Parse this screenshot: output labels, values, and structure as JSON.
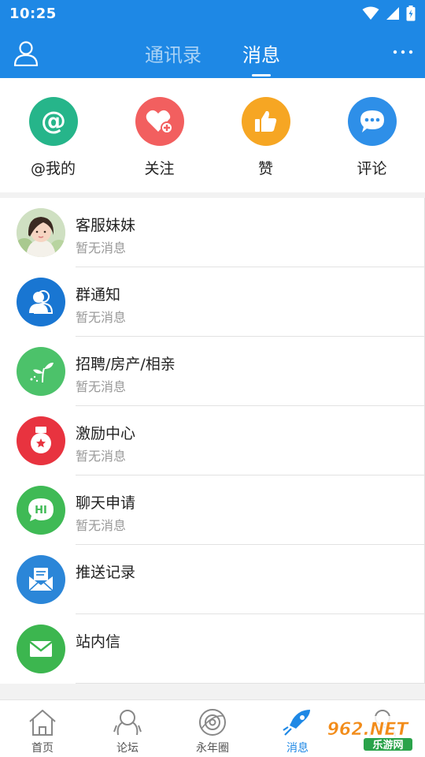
{
  "status": {
    "time": "10:25"
  },
  "nav": {
    "tabs": [
      {
        "label": "通讯录",
        "active": false
      },
      {
        "label": "消息",
        "active": true
      }
    ]
  },
  "quick_actions": [
    {
      "label": "@我的",
      "icon": "at-icon",
      "color": "#26b58a"
    },
    {
      "label": "关注",
      "icon": "heart-plus-icon",
      "color": "#f25f5f"
    },
    {
      "label": "赞",
      "icon": "thumbs-up-icon",
      "color": "#f6a623"
    },
    {
      "label": "评论",
      "icon": "comment-icon",
      "color": "#2e8fe8"
    }
  ],
  "list": [
    {
      "title": "客服妹妹",
      "subtitle": "暂无消息",
      "icon": "service-avatar"
    },
    {
      "title": "群通知",
      "subtitle": "暂无消息",
      "icon": "group-icon",
      "color": "#1976d2"
    },
    {
      "title": "招聘/房产/相亲",
      "subtitle": "暂无消息",
      "icon": "sprout-icon",
      "color": "#4cc26a"
    },
    {
      "title": "激励中心",
      "subtitle": "暂无消息",
      "icon": "medal-icon",
      "color": "#e8333f"
    },
    {
      "title": "聊天申请",
      "subtitle": "暂无消息",
      "icon": "hi-chat-icon",
      "color": "#3fba55"
    },
    {
      "title": "推送记录",
      "subtitle": "",
      "icon": "push-mail-icon",
      "color": "#2b86d8"
    },
    {
      "title": "站内信",
      "subtitle": "",
      "icon": "envelope-icon",
      "color": "#3cb64f"
    }
  ],
  "tabbar": [
    {
      "label": "首页",
      "icon": "home-icon",
      "active": false
    },
    {
      "label": "论坛",
      "icon": "forum-icon",
      "active": false
    },
    {
      "label": "永年圈",
      "icon": "circle-icon",
      "active": false
    },
    {
      "label": "消息",
      "icon": "message-rocket-icon",
      "active": true
    },
    {
      "label": "",
      "icon": "profile-icon",
      "active": false
    }
  ],
  "watermark": {
    "brand": "962.NET",
    "sub": "乐游网"
  }
}
